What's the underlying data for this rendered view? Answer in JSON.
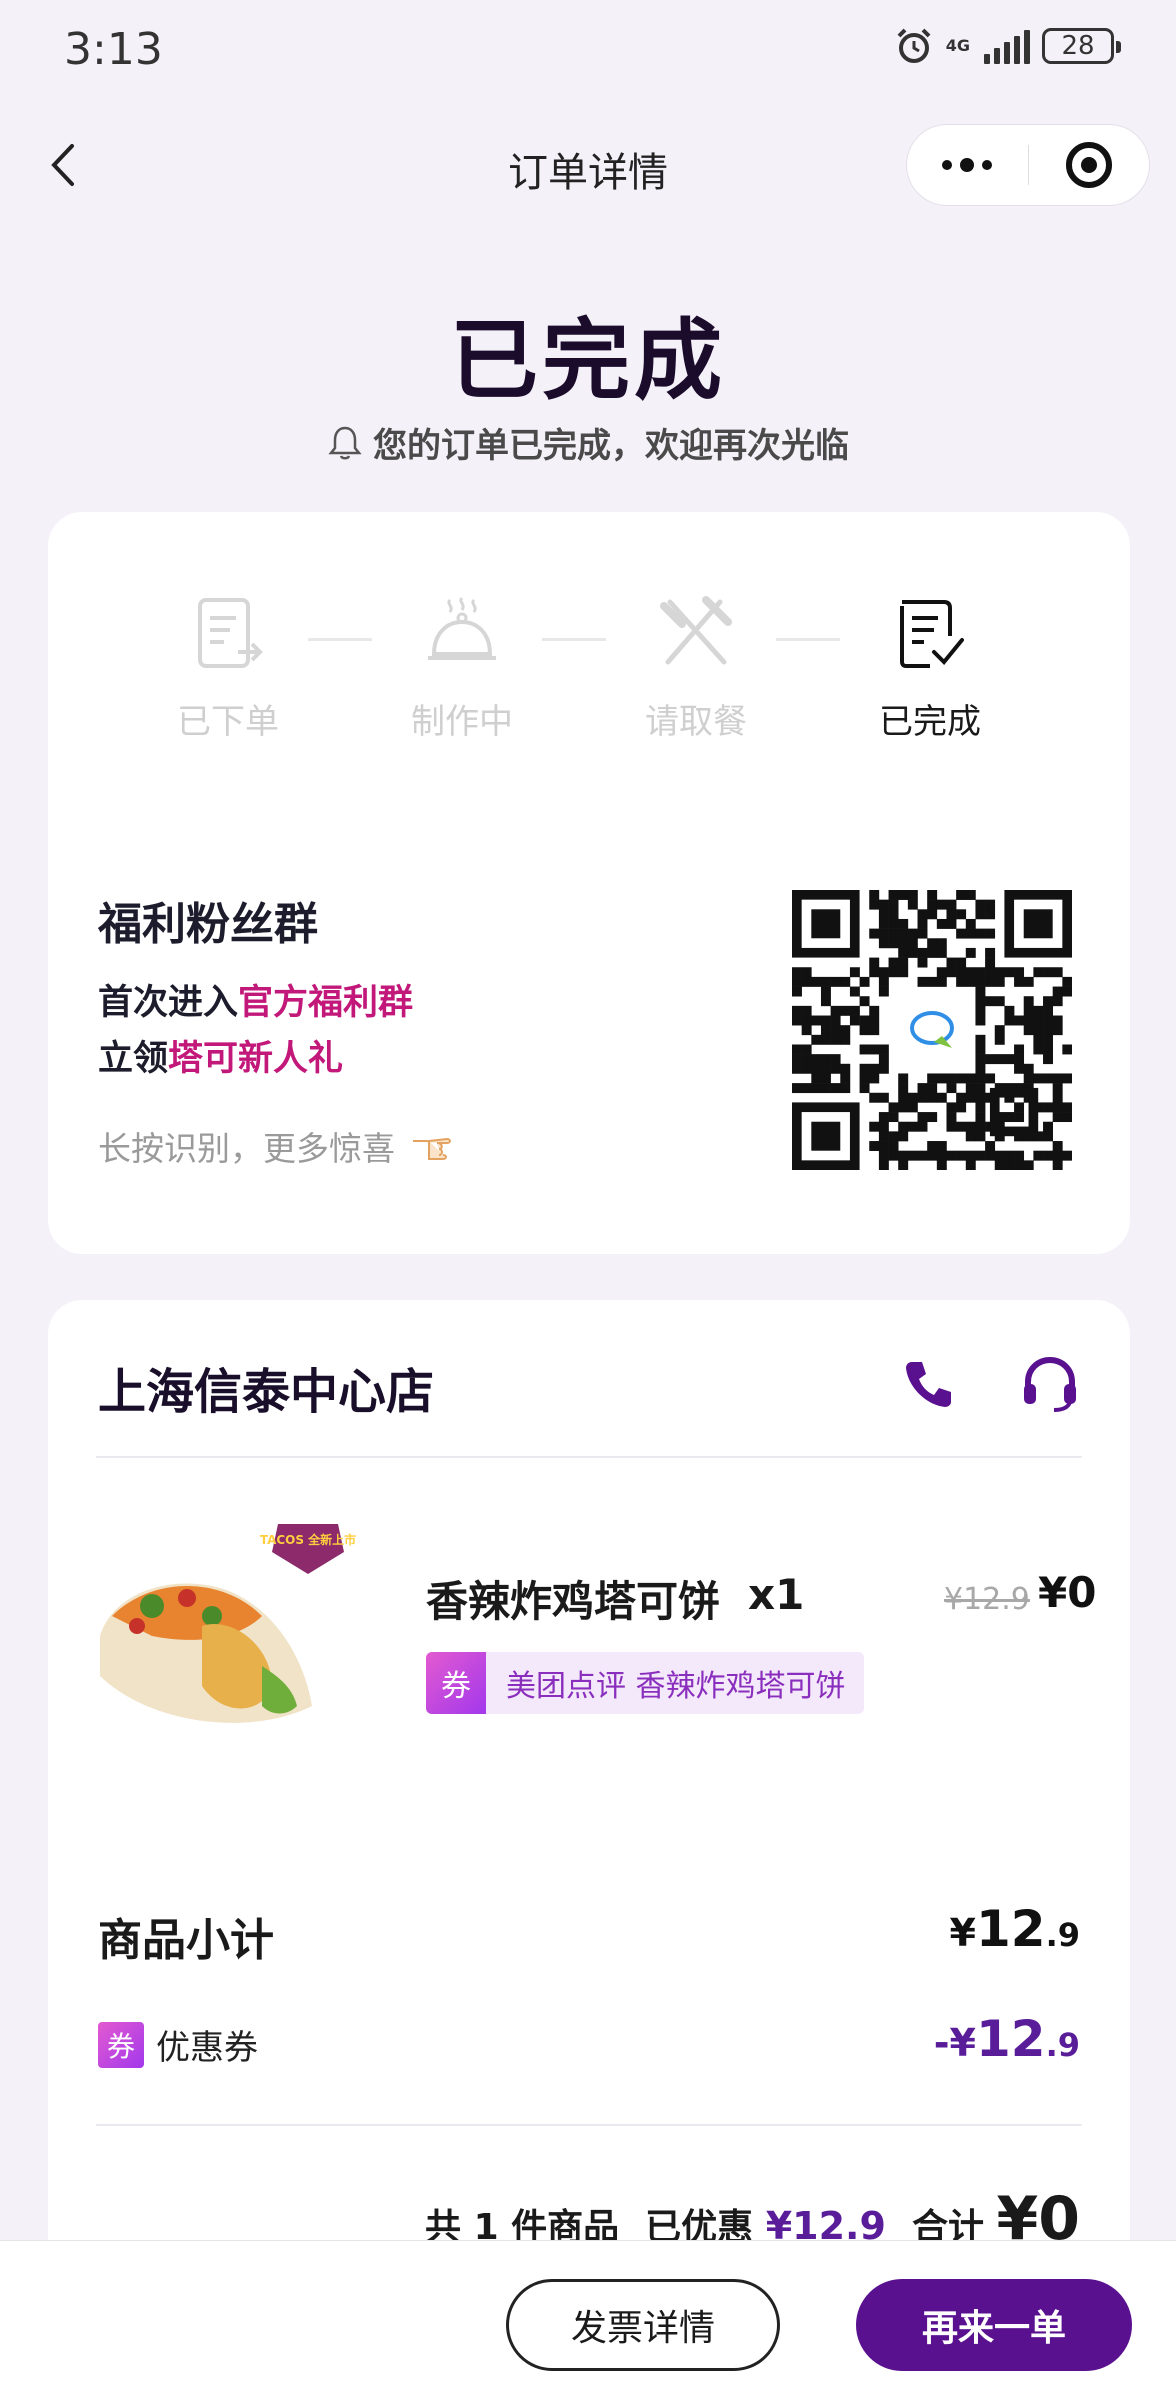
{
  "status_bar": {
    "time": "3:13",
    "network": "4G",
    "battery": "28"
  },
  "nav": {
    "title": "订单详情"
  },
  "order_status": {
    "title": "已完成",
    "subtitle": "您的订单已完成，欢迎再次光临"
  },
  "steps": [
    {
      "label": "已下单",
      "active": false
    },
    {
      "label": "制作中",
      "active": false
    },
    {
      "label": "请取餐",
      "active": false
    },
    {
      "label": "已完成",
      "active": true
    }
  ],
  "fans_group": {
    "title": "福利粉丝群",
    "line1_prefix": "首次进入",
    "line1_highlight": "官方福利群",
    "line2_prefix": "立领",
    "line2_highlight": "塔可新人礼",
    "tip": "长按识别，更多惊喜",
    "highlight_color": "#c2187a"
  },
  "store": {
    "name": "上海信泰中心店"
  },
  "item": {
    "badge_text": "TACOS 全新上市",
    "name": "香辣炸鸡塔可饼",
    "qty": "x1",
    "original_price": "¥12.9",
    "price": "¥0",
    "coupon_tag_icon": "券",
    "coupon_tag_text": "美团点评 香辣炸鸡塔可饼"
  },
  "subtotal": {
    "label": "商品小计",
    "currency": "¥",
    "int": "12",
    "dec": ".9"
  },
  "discount": {
    "icon": "券",
    "label": "优惠券",
    "currency": "-¥",
    "int": "12",
    "dec": ".9"
  },
  "summary": {
    "count_text": "共 1 件商品",
    "discount_label": "已优惠",
    "discount_value": "¥12.9",
    "total_label": "合计",
    "total_value": "¥0"
  },
  "buttons": {
    "invoice": "发票详情",
    "reorder": "再来一单"
  },
  "colors": {
    "accent": "#5a1190",
    "background": "#f4f1f9"
  }
}
